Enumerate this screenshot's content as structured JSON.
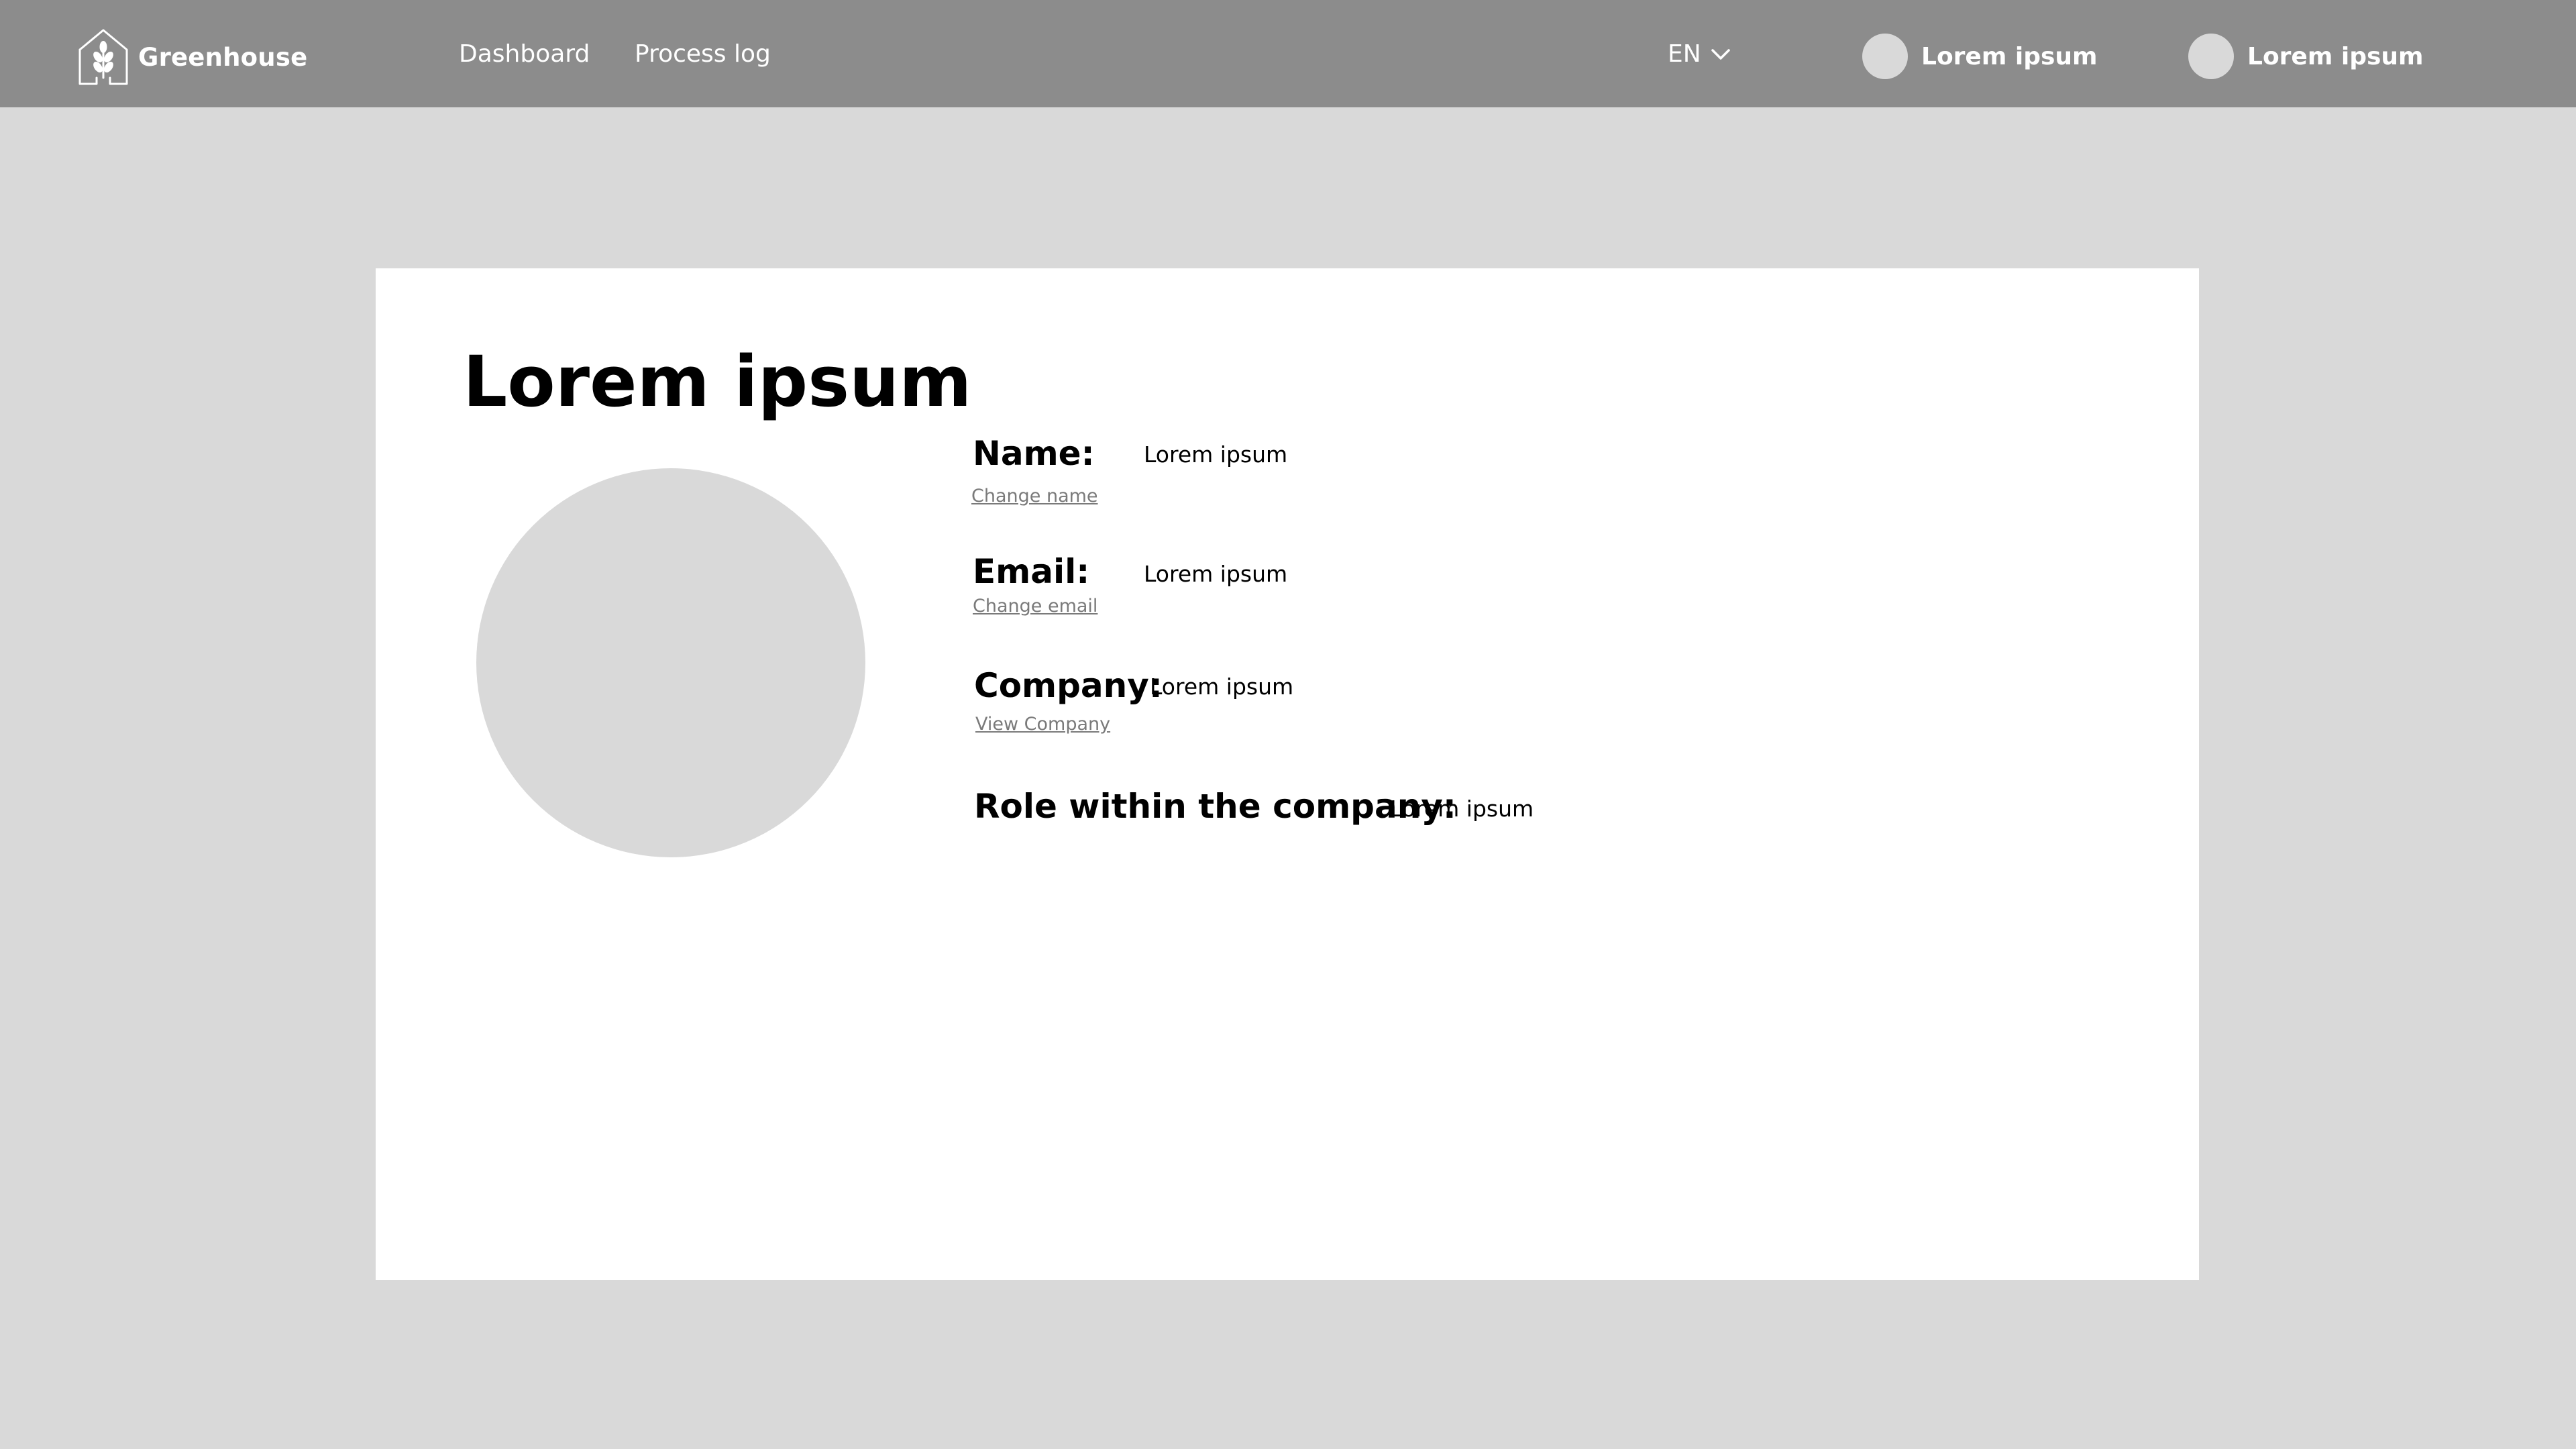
{
  "header": {
    "brand": {
      "name": "Greenhouse",
      "icon": "greenhouse-leaf-icon"
    },
    "nav": {
      "dashboard_label": "Dashboard",
      "process_log_label": "Process log"
    },
    "language": {
      "selected": "EN",
      "icon": "chevron-down-icon"
    },
    "user_chips": [
      {
        "label": "Lorem ipsum"
      },
      {
        "label": "Lorem ipsum"
      }
    ]
  },
  "profile": {
    "title": "Lorem ipsum",
    "fields": {
      "name": {
        "label": "Name:",
        "value": "Lorem ipsum",
        "action": "Change name"
      },
      "email": {
        "label": "Email:",
        "value": "Lorem ipsum",
        "action": "Change email"
      },
      "company": {
        "label": "Company:",
        "value": "Lorem ipsum",
        "action": "View Company"
      },
      "role": {
        "label": "Role within the company:",
        "value": "Lorem ipsum"
      }
    }
  },
  "colors": {
    "header_bg": "#8c8c8c",
    "page_bg": "#d9d9d9",
    "card_bg": "#ffffff",
    "placeholder": "#d9d9d9",
    "link": "#7a7a7a"
  }
}
